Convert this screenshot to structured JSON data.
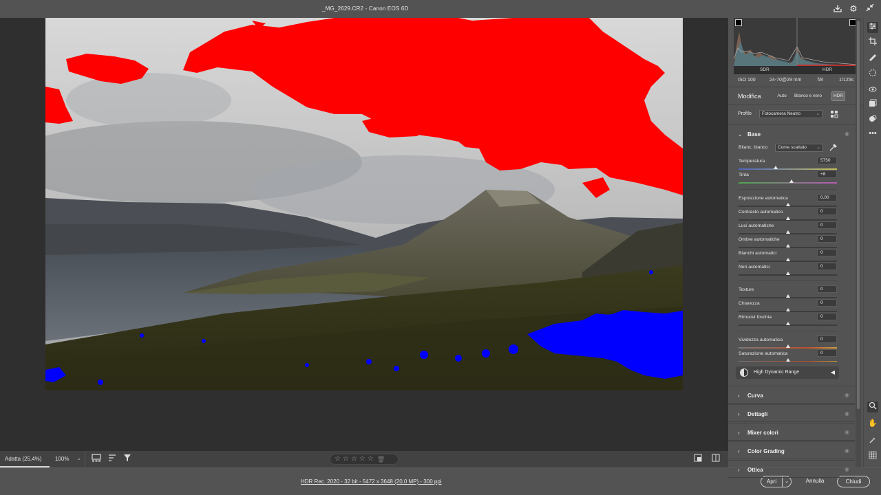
{
  "window": {
    "title": "_MG_2629.CR2  -  Canon EOS 6D"
  },
  "toolbar_icons": [
    "save-icon",
    "gear-icon",
    "collapse-icon"
  ],
  "bottombar": {
    "zoom_fit": "Adatta (25,4%)",
    "zoom_100": "100%",
    "rating": {
      "stars": 0,
      "max": 5
    }
  },
  "footer": {
    "info": "HDR Rec. 2020 - 32 bit - 5472 x 3648 (20,0 MP) - 300 ppi",
    "apri": "Apri",
    "annulla": "Annulla",
    "chiudi": "Chiudi"
  },
  "histogram": {
    "sdr_label": "SDR",
    "hdr_label": "HDR"
  },
  "exif": {
    "iso": "ISO 100",
    "lens": "24-70@29 mm",
    "aperture": "f/8",
    "shutter": "1/125s"
  },
  "edit": {
    "title": "Modifica",
    "auto": "Auto",
    "bw": "Blanco e nero",
    "hdr": "HDR",
    "profile_label": "Profilo",
    "profile_value": "Fotocamera Neutro"
  },
  "base": {
    "title": "Base",
    "wb_label": "Bilanc. bianco",
    "wb_value": "Come scattato",
    "sliders": [
      {
        "label": "Temperatura",
        "value": "5750",
        "pos": 0.38
      },
      {
        "label": "Tinta",
        "value": "+8",
        "pos": 0.54
      },
      {
        "label": "Esposizione automatica",
        "value": "0.00",
        "pos": 0.5
      },
      {
        "label": "Contrasto automatico",
        "value": "0",
        "pos": 0.5
      },
      {
        "label": "Luci automatiche",
        "value": "0",
        "pos": 0.5
      },
      {
        "label": "Ombre automatiche",
        "value": "0",
        "pos": 0.5
      },
      {
        "label": "Bianchi automatici",
        "value": "0",
        "pos": 0.5
      },
      {
        "label": "Neri automatici",
        "value": "0",
        "pos": 0.5
      },
      {
        "label": "Texture",
        "value": "0",
        "pos": 0.5
      },
      {
        "label": "Chiarezza",
        "value": "0",
        "pos": 0.5
      },
      {
        "label": "Rimuovi foschia",
        "value": "0",
        "pos": 0.5
      },
      {
        "label": "Vividezza automatica",
        "value": "0",
        "pos": 0.5
      },
      {
        "label": "Saturazione automatica",
        "value": "0",
        "pos": 0.5
      }
    ],
    "hdr_range": "High Dynamic Range"
  },
  "sections": [
    "Curva",
    "Dettagli",
    "Mixer colori",
    "Color Grading",
    "Ottica"
  ],
  "colors": {
    "clip_highlight": "#ff0000",
    "clip_shadow": "#0000ff",
    "panel_bg": "#535353",
    "canvas_bg": "#2f2f2f"
  }
}
